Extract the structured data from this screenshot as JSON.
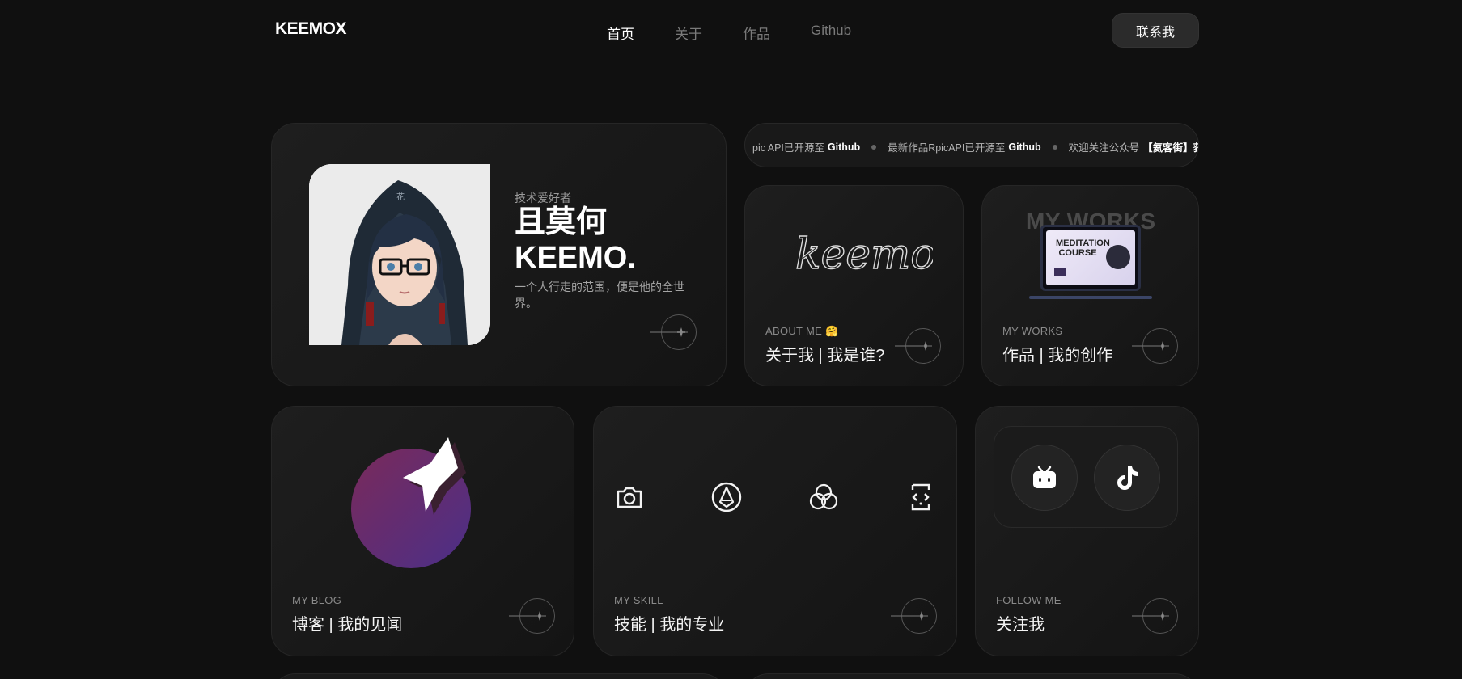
{
  "header": {
    "logo": "KEEMOX",
    "nav": [
      {
        "label": "首页",
        "active": true
      },
      {
        "label": "关于",
        "active": false
      },
      {
        "label": "作品",
        "active": false
      },
      {
        "label": "Github",
        "active": false
      }
    ],
    "contact_label": "联系我"
  },
  "profile": {
    "tag": "技术爱好者",
    "name_cn": "且莫何",
    "name_en": "KEEMO.",
    "desc": "一个人行走的范围，便是他的全世界。",
    "avatar_icon": "anime-avatar-icon"
  },
  "ticker": {
    "items": [
      {
        "text": "pic API已开源至",
        "bold": "Github"
      },
      {
        "text": "最新作品RpicAPI已开源至",
        "bold": "Github"
      },
      {
        "text": "欢迎关注公众号",
        "bold": "【氦客街】获"
      }
    ]
  },
  "about": {
    "signature": "keemo",
    "sub": "ABOUT ME 🤗",
    "title": "关于我 | 我是谁?"
  },
  "works": {
    "banner": "MY WORKS",
    "preview_title": "MEDITATION COURSE",
    "sub": "MY WORKS",
    "title": "作品 | 我的创作"
  },
  "blog": {
    "sub": "MY BLOG",
    "title": "博客 | 我的见闻"
  },
  "skill": {
    "icons": [
      "camera-icon",
      "pen-nib-icon",
      "color-circles-icon",
      "code-brackets-icon"
    ],
    "sub": "MY SKILL",
    "title": "技能 | 我的专业"
  },
  "follow": {
    "icons": [
      "bilibili-icon",
      "tiktok-icon"
    ],
    "sub": "FOLLOW ME",
    "title": "关注我"
  },
  "colors": {
    "background": "#101010",
    "card": "#1c1c1c",
    "accent_purple": "#6b2e78"
  }
}
